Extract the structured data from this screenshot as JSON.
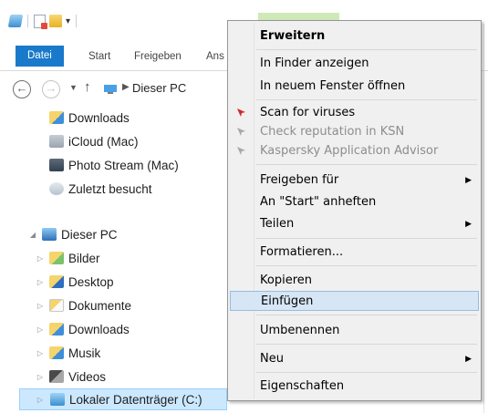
{
  "qat": {
    "dropdown_glyph": "▾"
  },
  "ribbon": {
    "tabs": [
      "Datei",
      "Start",
      "Freigeben",
      "Ans"
    ]
  },
  "address": {
    "crumb": "Dieser PC"
  },
  "nav": {
    "items": [
      {
        "label": "Downloads",
        "icon": "downloads-folder-icon"
      },
      {
        "label": "iCloud (Mac)",
        "icon": "icloud-icon"
      },
      {
        "label": "Photo Stream (Mac)",
        "icon": "photo-stream-icon"
      },
      {
        "label": "Zuletzt besucht",
        "icon": "recent-places-icon"
      },
      {
        "label": "Dieser PC",
        "icon": "this-pc-icon"
      },
      {
        "label": "Bilder",
        "icon": "pictures-folder-icon"
      },
      {
        "label": "Desktop",
        "icon": "desktop-folder-icon"
      },
      {
        "label": "Dokumente",
        "icon": "documents-folder-icon"
      },
      {
        "label": "Downloads",
        "icon": "downloads-folder-icon"
      },
      {
        "label": "Musik",
        "icon": "music-folder-icon"
      },
      {
        "label": "Videos",
        "icon": "videos-folder-icon"
      },
      {
        "label": "Lokaler Datenträger (C:)",
        "icon": "local-drive-icon"
      }
    ]
  },
  "context_menu": {
    "items": [
      {
        "label": "Erweitern",
        "bold": true
      },
      {
        "label": "In Finder anzeigen"
      },
      {
        "label": "In neuem Fenster öffnen"
      },
      {
        "label": "Scan for viruses",
        "icon": "kaspersky-scan-icon"
      },
      {
        "label": "Check reputation in KSN",
        "icon": "kaspersky-ksn-icon",
        "disabled": true
      },
      {
        "label": "Kaspersky Application Advisor",
        "icon": "kaspersky-advisor-icon",
        "disabled": true
      },
      {
        "label": "Freigeben für",
        "submenu": true
      },
      {
        "label": "An \"Start\" anheften"
      },
      {
        "label": "Teilen",
        "submenu": true
      },
      {
        "label": "Formatieren..."
      },
      {
        "label": "Kopieren"
      },
      {
        "label": "Einfügen",
        "hover": true
      },
      {
        "label": "Umbenennen"
      },
      {
        "label": "Neu",
        "submenu": true
      },
      {
        "label": "Eigenschaften"
      }
    ],
    "submenu_glyph": "▶"
  },
  "colors": {
    "accent": "#1979ca",
    "menu_hover": "#d6e6f5",
    "selection": "#cce8ff"
  }
}
